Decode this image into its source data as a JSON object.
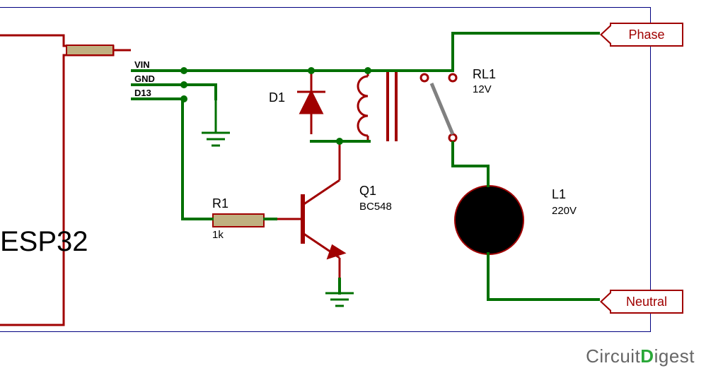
{
  "module": {
    "name": "ESP32",
    "pins": {
      "vin": "VIN",
      "gnd": "GND",
      "d13": "D13"
    }
  },
  "components": {
    "r1": {
      "designator": "R1",
      "value": "1k"
    },
    "d1": {
      "designator": "D1"
    },
    "q1": {
      "designator": "Q1",
      "value": "BC548"
    },
    "rl1": {
      "designator": "RL1",
      "value": "12V"
    },
    "l1": {
      "designator": "L1",
      "value": "220V"
    }
  },
  "terminals": {
    "phase": "Phase",
    "neutral": "Neutral"
  },
  "watermark": {
    "part1": "Circuit",
    "part2": "D",
    "part3": "igest"
  }
}
